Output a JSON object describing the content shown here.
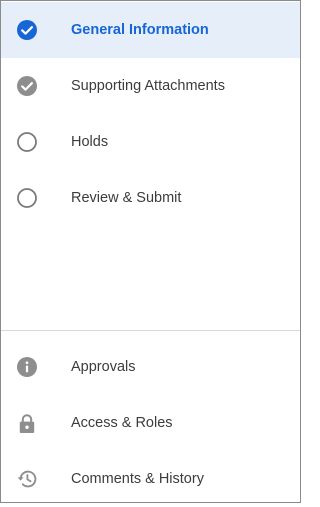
{
  "steps": [
    {
      "label": "General Information",
      "icon": "check-circle-icon",
      "state": "active"
    },
    {
      "label": "Supporting Attachments",
      "icon": "check-circle-icon",
      "state": "completed"
    },
    {
      "label": "Holds",
      "icon": "empty-circle-icon",
      "state": "pending"
    },
    {
      "label": "Review & Submit",
      "icon": "empty-circle-icon",
      "state": "pending"
    }
  ],
  "secondary": [
    {
      "label": "Approvals",
      "icon": "info-icon"
    },
    {
      "label": "Access & Roles",
      "icon": "lock-icon"
    },
    {
      "label": "Comments & History",
      "icon": "history-icon"
    }
  ],
  "colors": {
    "accent": "#1766d6",
    "active_background": "#e6eefa",
    "completed_icon": "#8e8e8e",
    "pending_icon": "#7a7a7a",
    "text": "#3c3c3c",
    "border": "#8a8a8a"
  }
}
